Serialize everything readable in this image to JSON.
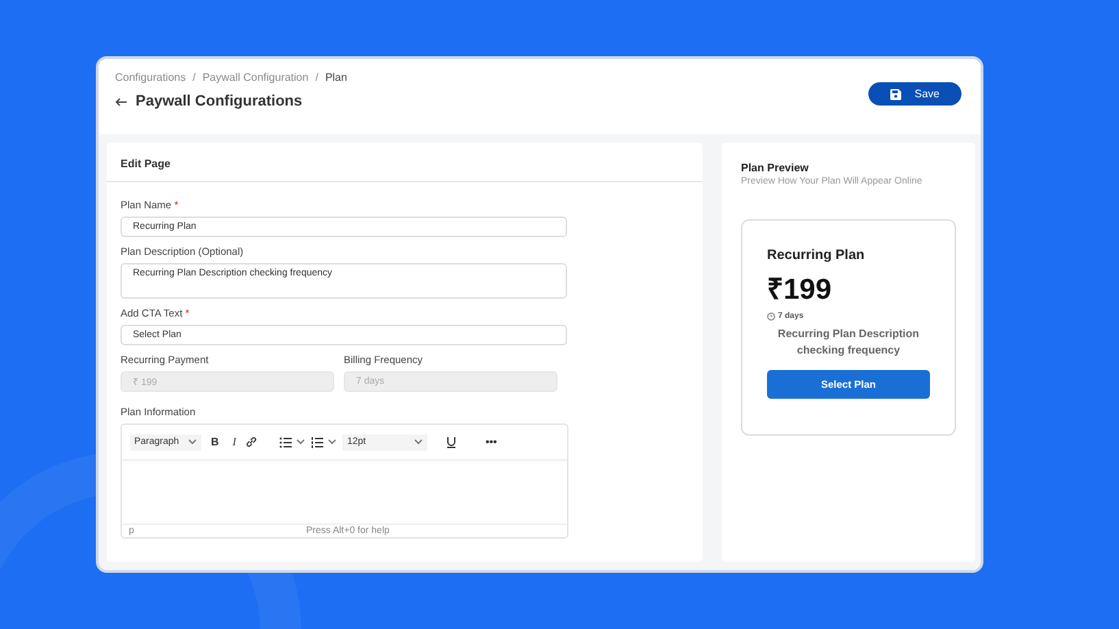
{
  "breadcrumbs": [
    {
      "label": "Configurations",
      "selected": false
    },
    {
      "label": "Paywall Configuration",
      "selected": false
    },
    {
      "label": "Plan",
      "selected": true
    }
  ],
  "breadcrumb_separator": "/",
  "title": "Paywall Configurations",
  "save_button": {
    "label": "Save"
  },
  "editor": {
    "title": "Edit Page",
    "fields": [
      {
        "kind": "text",
        "label": "Plan Name",
        "required_mark": "*",
        "value": "Recurring Plan",
        "disabled": false
      },
      {
        "kind": "textarea",
        "label": "Plan Description (Optional)",
        "value": "Recurring Plan Description checking frequency",
        "disabled": false
      },
      {
        "kind": "text",
        "label": "Add CTA Text",
        "required_mark": "*",
        "value": "Select Plan",
        "disabled": false
      },
      {
        "kind": "half",
        "label": "Recurring Payment",
        "value": "₹ 199",
        "disabled": true
      },
      {
        "kind": "half",
        "label": "Billing Frequency",
        "value": "7 days",
        "disabled": true
      }
    ],
    "rich_text": {
      "label": "Plan Information",
      "toolbar": [
        {
          "kind": "select",
          "label": "Paragraph"
        },
        {
          "kind": "bold",
          "label": "B"
        },
        {
          "kind": "italic",
          "label": "I"
        },
        {
          "kind": "link"
        },
        {
          "kind": "bullets"
        },
        {
          "kind": "numbers"
        },
        {
          "kind": "select",
          "label": "12pt"
        },
        {
          "kind": "underline"
        },
        {
          "kind": "more",
          "label": "•••"
        }
      ],
      "path": "p",
      "help": "Press Alt+0 for help"
    }
  },
  "preview": {
    "title": "Plan Preview",
    "subtitle": "Preview How Your Plan Will Appear Online",
    "card": {
      "name": "Recurring Plan",
      "price": "₹199",
      "period": "7 days",
      "description": "Recurring Plan Description checking frequency",
      "cta": "Select Plan"
    }
  }
}
